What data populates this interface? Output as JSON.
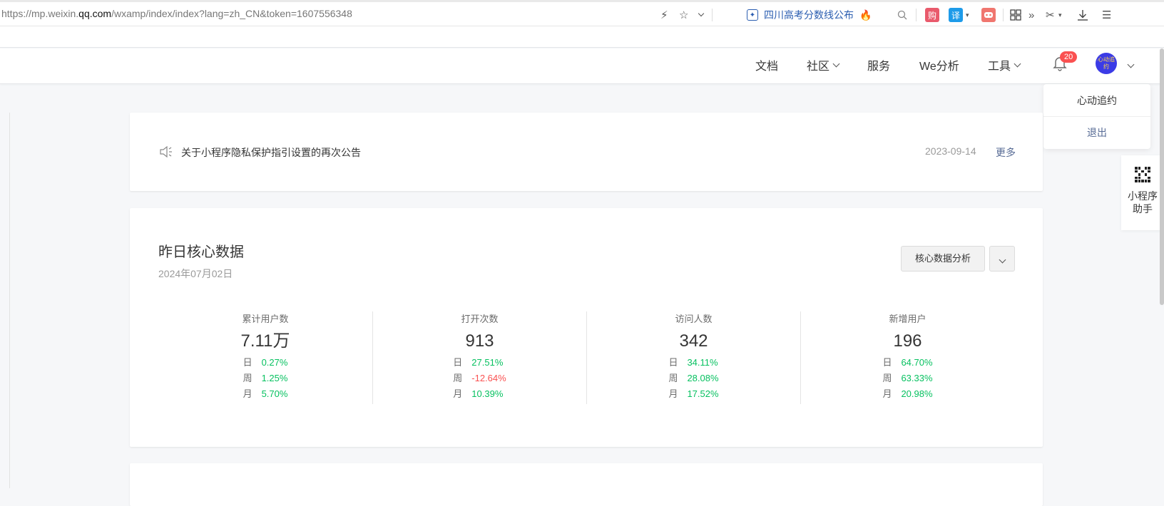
{
  "browser": {
    "url_prefix": "https://mp.weixin.",
    "url_host": "qq.com",
    "url_path": "/wxamp/index/index?lang=zh_CN&token=1607556348",
    "bookmark_text": "四川高考分数线公布",
    "ext_buy": "购",
    "ext_translate": "译"
  },
  "nav": {
    "docs": "文档",
    "community": "社区",
    "service": "服务",
    "we_analysis": "We分析",
    "tools": "工具",
    "notification_count": "20",
    "avatar_text": "心动追约"
  },
  "user_menu": {
    "name": "心动追约",
    "logout": "退出"
  },
  "assistant": {
    "label_line1": "小程序",
    "label_line2": "助手"
  },
  "notice": {
    "text": "关于小程序隐私保护指引设置的再次公告",
    "date": "2023-09-14",
    "more": "更多"
  },
  "core": {
    "title": "昨日核心数据",
    "date": "2024年07月02日",
    "analysis_button": "核心数据分析",
    "stats": [
      {
        "label": "累计用户数",
        "value": "7.11万",
        "rows": [
          {
            "k": "日",
            "v": "0.27%",
            "trend": "up"
          },
          {
            "k": "周",
            "v": "1.25%",
            "trend": "up"
          },
          {
            "k": "月",
            "v": "5.70%",
            "trend": "up"
          }
        ]
      },
      {
        "label": "打开次数",
        "value": "913",
        "rows": [
          {
            "k": "日",
            "v": "27.51%",
            "trend": "up"
          },
          {
            "k": "周",
            "v": "-12.64%",
            "trend": "down"
          },
          {
            "k": "月",
            "v": "10.39%",
            "trend": "up"
          }
        ]
      },
      {
        "label": "访问人数",
        "value": "342",
        "rows": [
          {
            "k": "日",
            "v": "34.11%",
            "trend": "up"
          },
          {
            "k": "周",
            "v": "28.08%",
            "trend": "up"
          },
          {
            "k": "月",
            "v": "17.52%",
            "trend": "up"
          }
        ]
      },
      {
        "label": "新增用户",
        "value": "196",
        "rows": [
          {
            "k": "日",
            "v": "64.70%",
            "trend": "up"
          },
          {
            "k": "周",
            "v": "63.33%",
            "trend": "up"
          },
          {
            "k": "月",
            "v": "20.98%",
            "trend": "up"
          }
        ]
      }
    ]
  },
  "colors": {
    "positive": "#07c160",
    "negative": "#fa5151",
    "link": "#576b95"
  }
}
